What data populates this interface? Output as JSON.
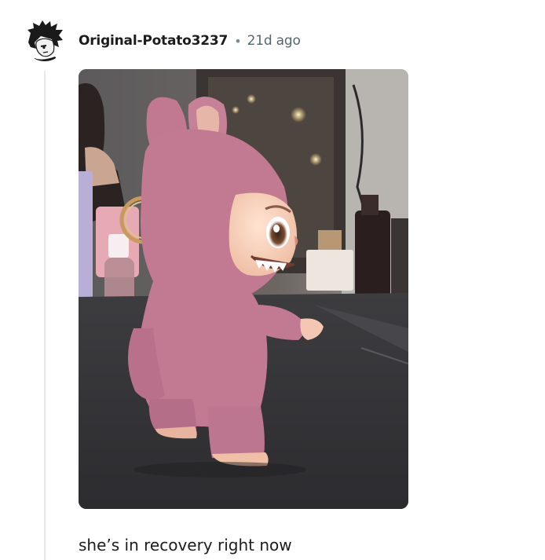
{
  "comment": {
    "username": "Original-Potato3237",
    "separator": "•",
    "timestamp": "21d ago",
    "body": "she’s in recovery right now"
  },
  "avatar": {
    "icon": "user-avatar-icon"
  },
  "media": {
    "icon": "plush-figure-photo"
  },
  "colors": {
    "username": "#1c1c1c",
    "timestamp": "#55656d",
    "thread_line": "#e6e8ea",
    "plush_pink": "#c27a93"
  }
}
